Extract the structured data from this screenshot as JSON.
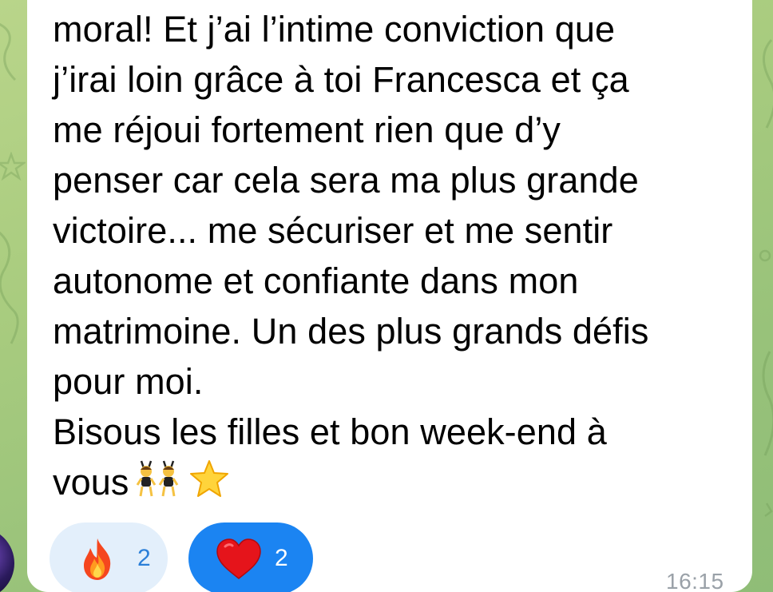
{
  "message": {
    "lines": [
      "moral! Et j’ai l’intime conviction que",
      "j’irai loin grâce à toi Francesca et ça",
      "me réjoui fortement rien que d’y",
      "penser car cela sera ma plus grande",
      "victoire... me sécuriser et me sentir",
      "autonome et confiante dans mon",
      "matrimoine. Un des plus grands défis",
      "pour moi.",
      "Bisous les filles et bon week-end à",
      "vous"
    ],
    "trailing_emojis": [
      "women-with-bunny-ears-emoji",
      "star-emoji"
    ],
    "time": "16:15"
  },
  "reactions": [
    {
      "emoji": "fire-icon",
      "count": "2",
      "selected": false
    },
    {
      "emoji": "red-heart-icon",
      "count": "2",
      "selected": true
    }
  ],
  "colors": {
    "bubble": "#ffffff",
    "chat_background": "#a9cc7f",
    "reaction_default_bg": "#e3effb",
    "reaction_selected_bg": "#1b84f2",
    "reaction_default_text": "#2b7fd8",
    "timestamp": "#9aa1a8"
  }
}
